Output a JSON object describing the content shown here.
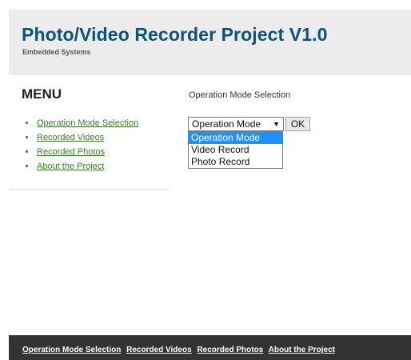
{
  "header": {
    "title": "Photo/Video Recorder Project V1.0",
    "subtitle": "Embedded Systems"
  },
  "menu": {
    "title": "MENU",
    "items": [
      {
        "label": "Operation Mode Selection"
      },
      {
        "label": "Recorded Videos"
      },
      {
        "label": "Recorded Photos"
      },
      {
        "label": "About the Project"
      }
    ]
  },
  "main": {
    "heading": "Operation Mode Selection",
    "select": {
      "selected": "Operation Mode",
      "options": [
        "Operation Mode",
        "Video Record",
        "Photo Record"
      ],
      "highlighted_option": "Operation Mode"
    },
    "ok_label": "OK"
  },
  "footer": {
    "links": [
      {
        "label": "Operation Mode Selection"
      },
      {
        "label": "Recorded Videos"
      },
      {
        "label": "Recorded Photos"
      },
      {
        "label": "About the Project"
      }
    ]
  },
  "colors": {
    "title": "#0e5278",
    "link": "#3d7a2a",
    "footer_bg": "#333333",
    "header_bg": "#ececec",
    "dropdown_highlight": "#1e90ff"
  }
}
